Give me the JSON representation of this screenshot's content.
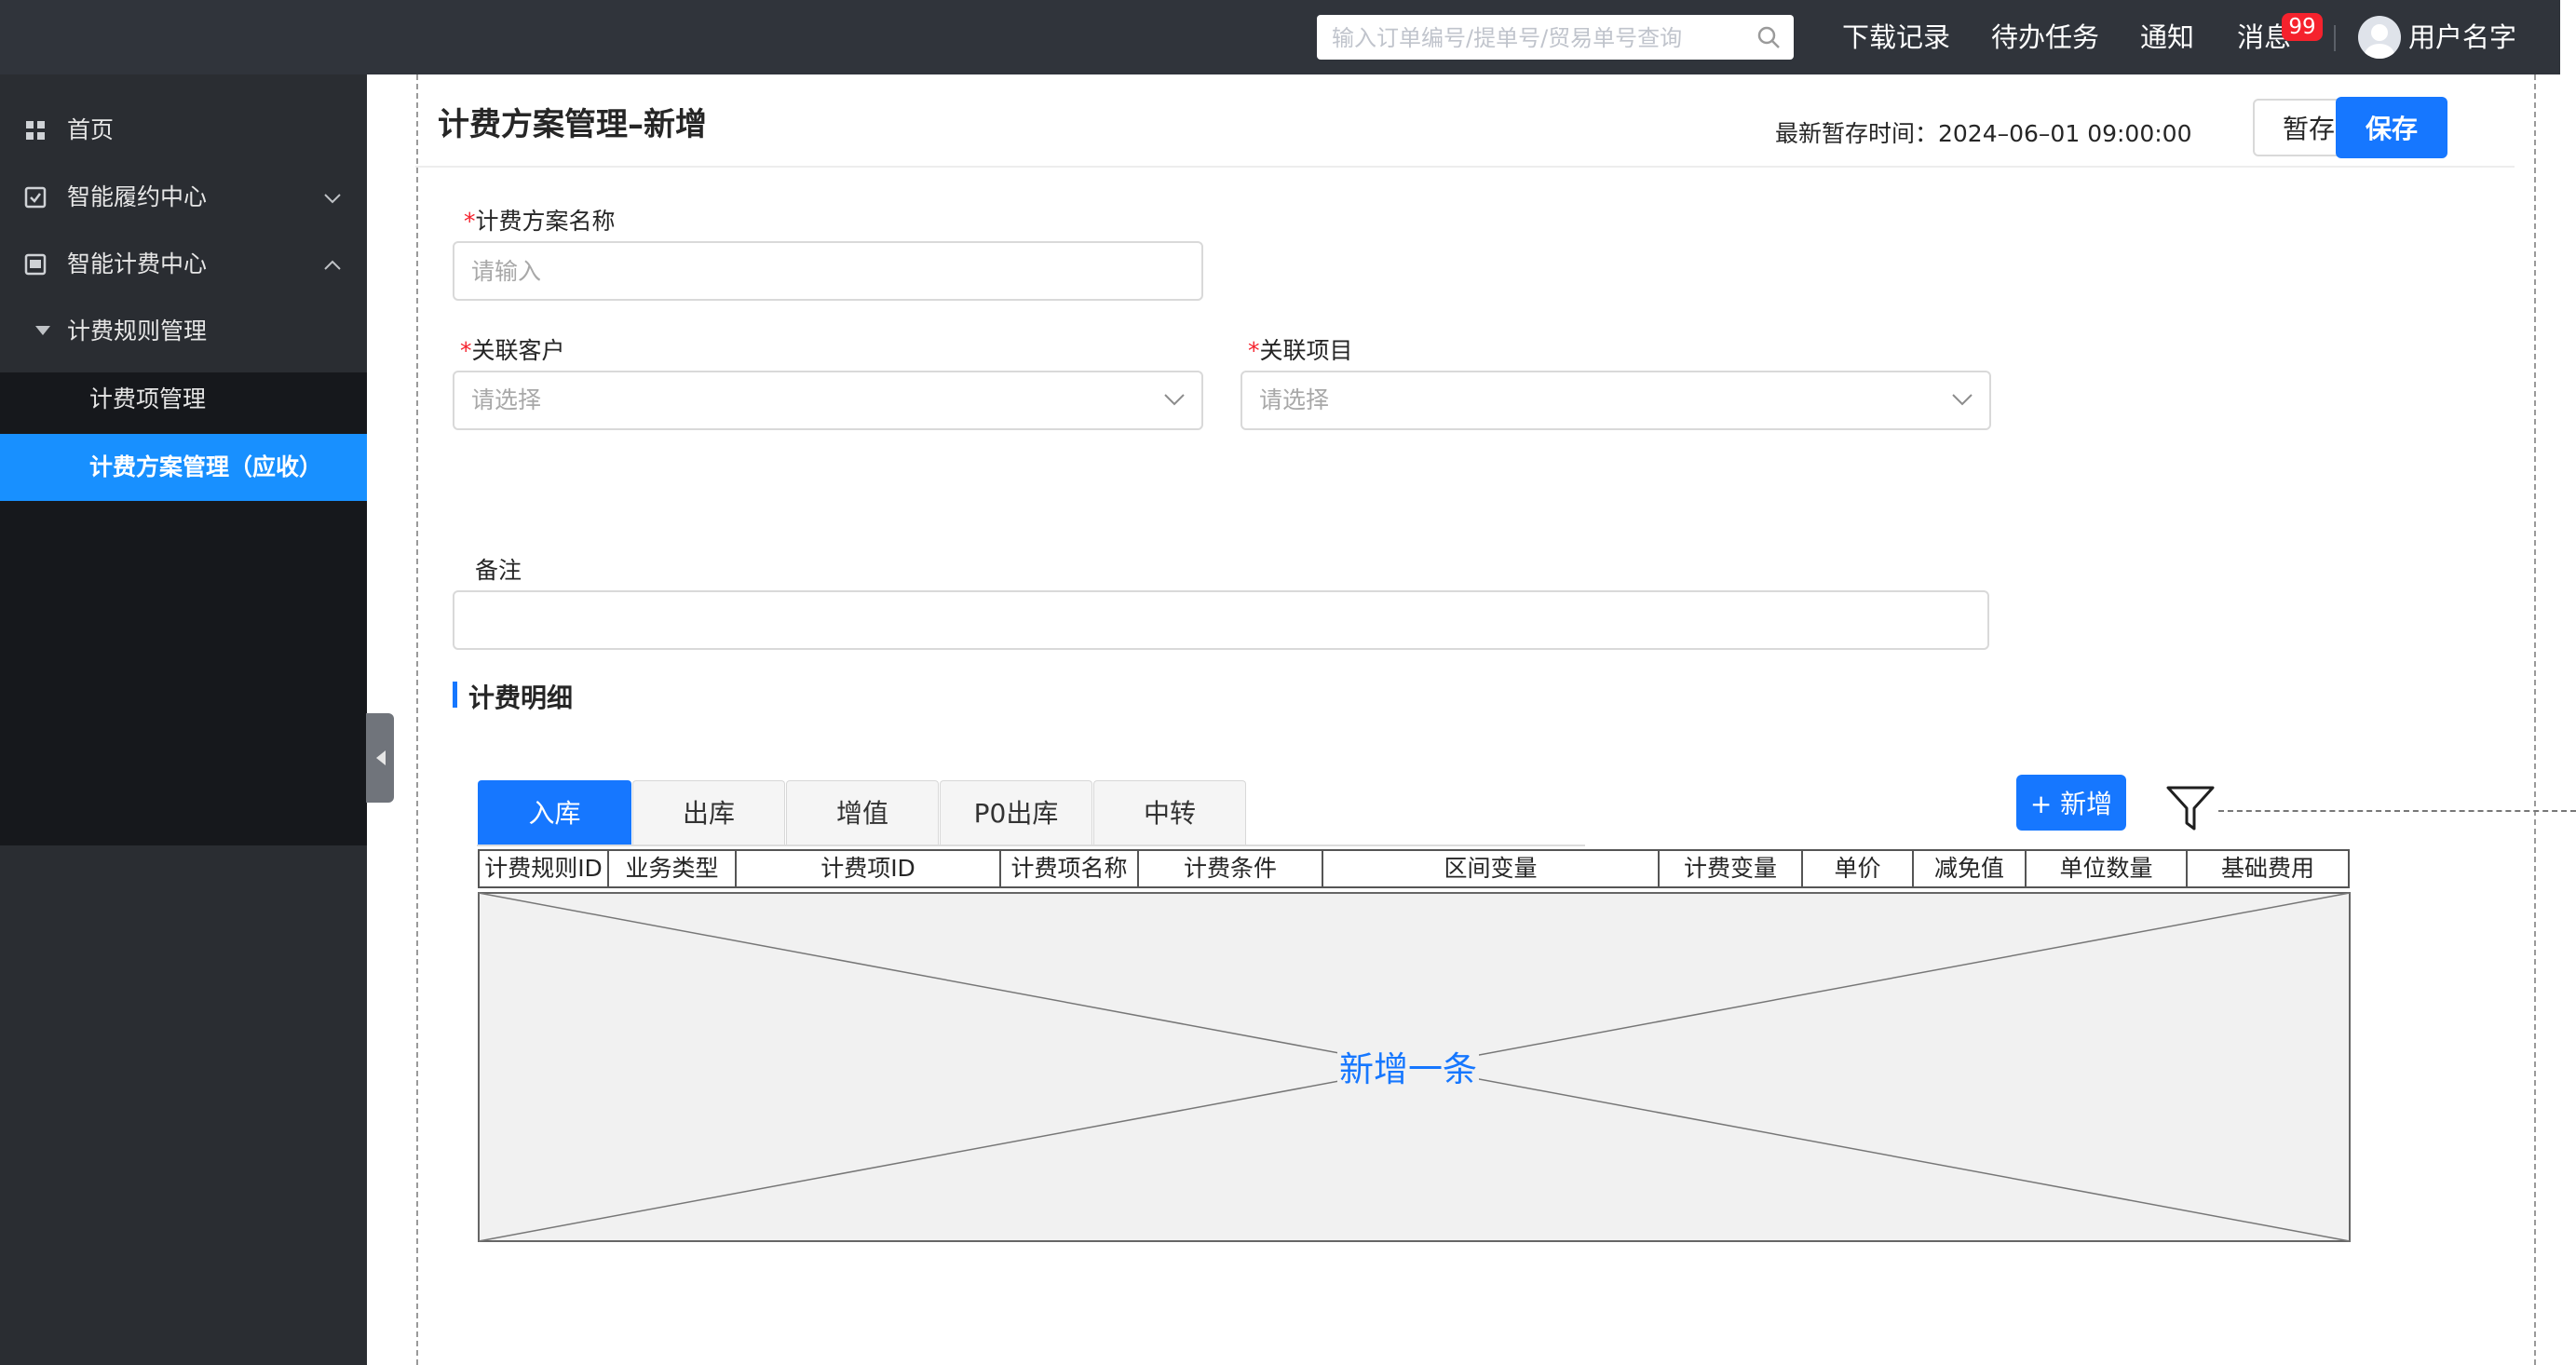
{
  "header": {
    "search_placeholder": "输入订单编号/提单号/贸易单号查询",
    "nav": [
      "下载记录",
      "待办任务",
      "通知",
      "消息"
    ],
    "message_badge": "99",
    "user_name": "用户名字"
  },
  "sidebar": {
    "items": [
      {
        "label": "首页",
        "icon": "grid-icon"
      },
      {
        "label": "智能履约中心",
        "icon": "checkbox-icon"
      },
      {
        "label": "智能计费中心",
        "icon": "image-icon"
      },
      {
        "label": "计费规则管理"
      },
      {
        "label": "计费项管理"
      },
      {
        "label": "计费方案管理（应收）"
      }
    ]
  },
  "page": {
    "title": "计费方案管理–新增",
    "last_save": "最新暂存时间：2024–06–01 09:00:00",
    "draft_button": "暂存",
    "save_button": "保存"
  },
  "form": {
    "plan_name_label": "计费方案名称",
    "plan_name_placeholder": "请输入",
    "customer_label": "关联客户",
    "customer_placeholder": "请选择",
    "project_label": "关联项目",
    "project_placeholder": "请选择",
    "remark_label": "备注",
    "required_mark": "*"
  },
  "details": {
    "section_title": "计费明细",
    "tabs": [
      "入库",
      "出库",
      "增值",
      "P0出库",
      "中转"
    ],
    "active_tab": "入库",
    "add_button": "+ 新增",
    "columns": [
      "计费规则ID",
      "业务类型",
      "计费项ID",
      "计费项名称",
      "计费条件",
      "区间变量",
      "计费变量",
      "单价",
      "减免值",
      "单位数量",
      "基础费用"
    ],
    "empty_text": "新增一条"
  },
  "colors": {
    "primary": "#1677ff",
    "topbar": "#30343b",
    "sidebar": "#2a2d32",
    "badge": "#f5222d"
  }
}
